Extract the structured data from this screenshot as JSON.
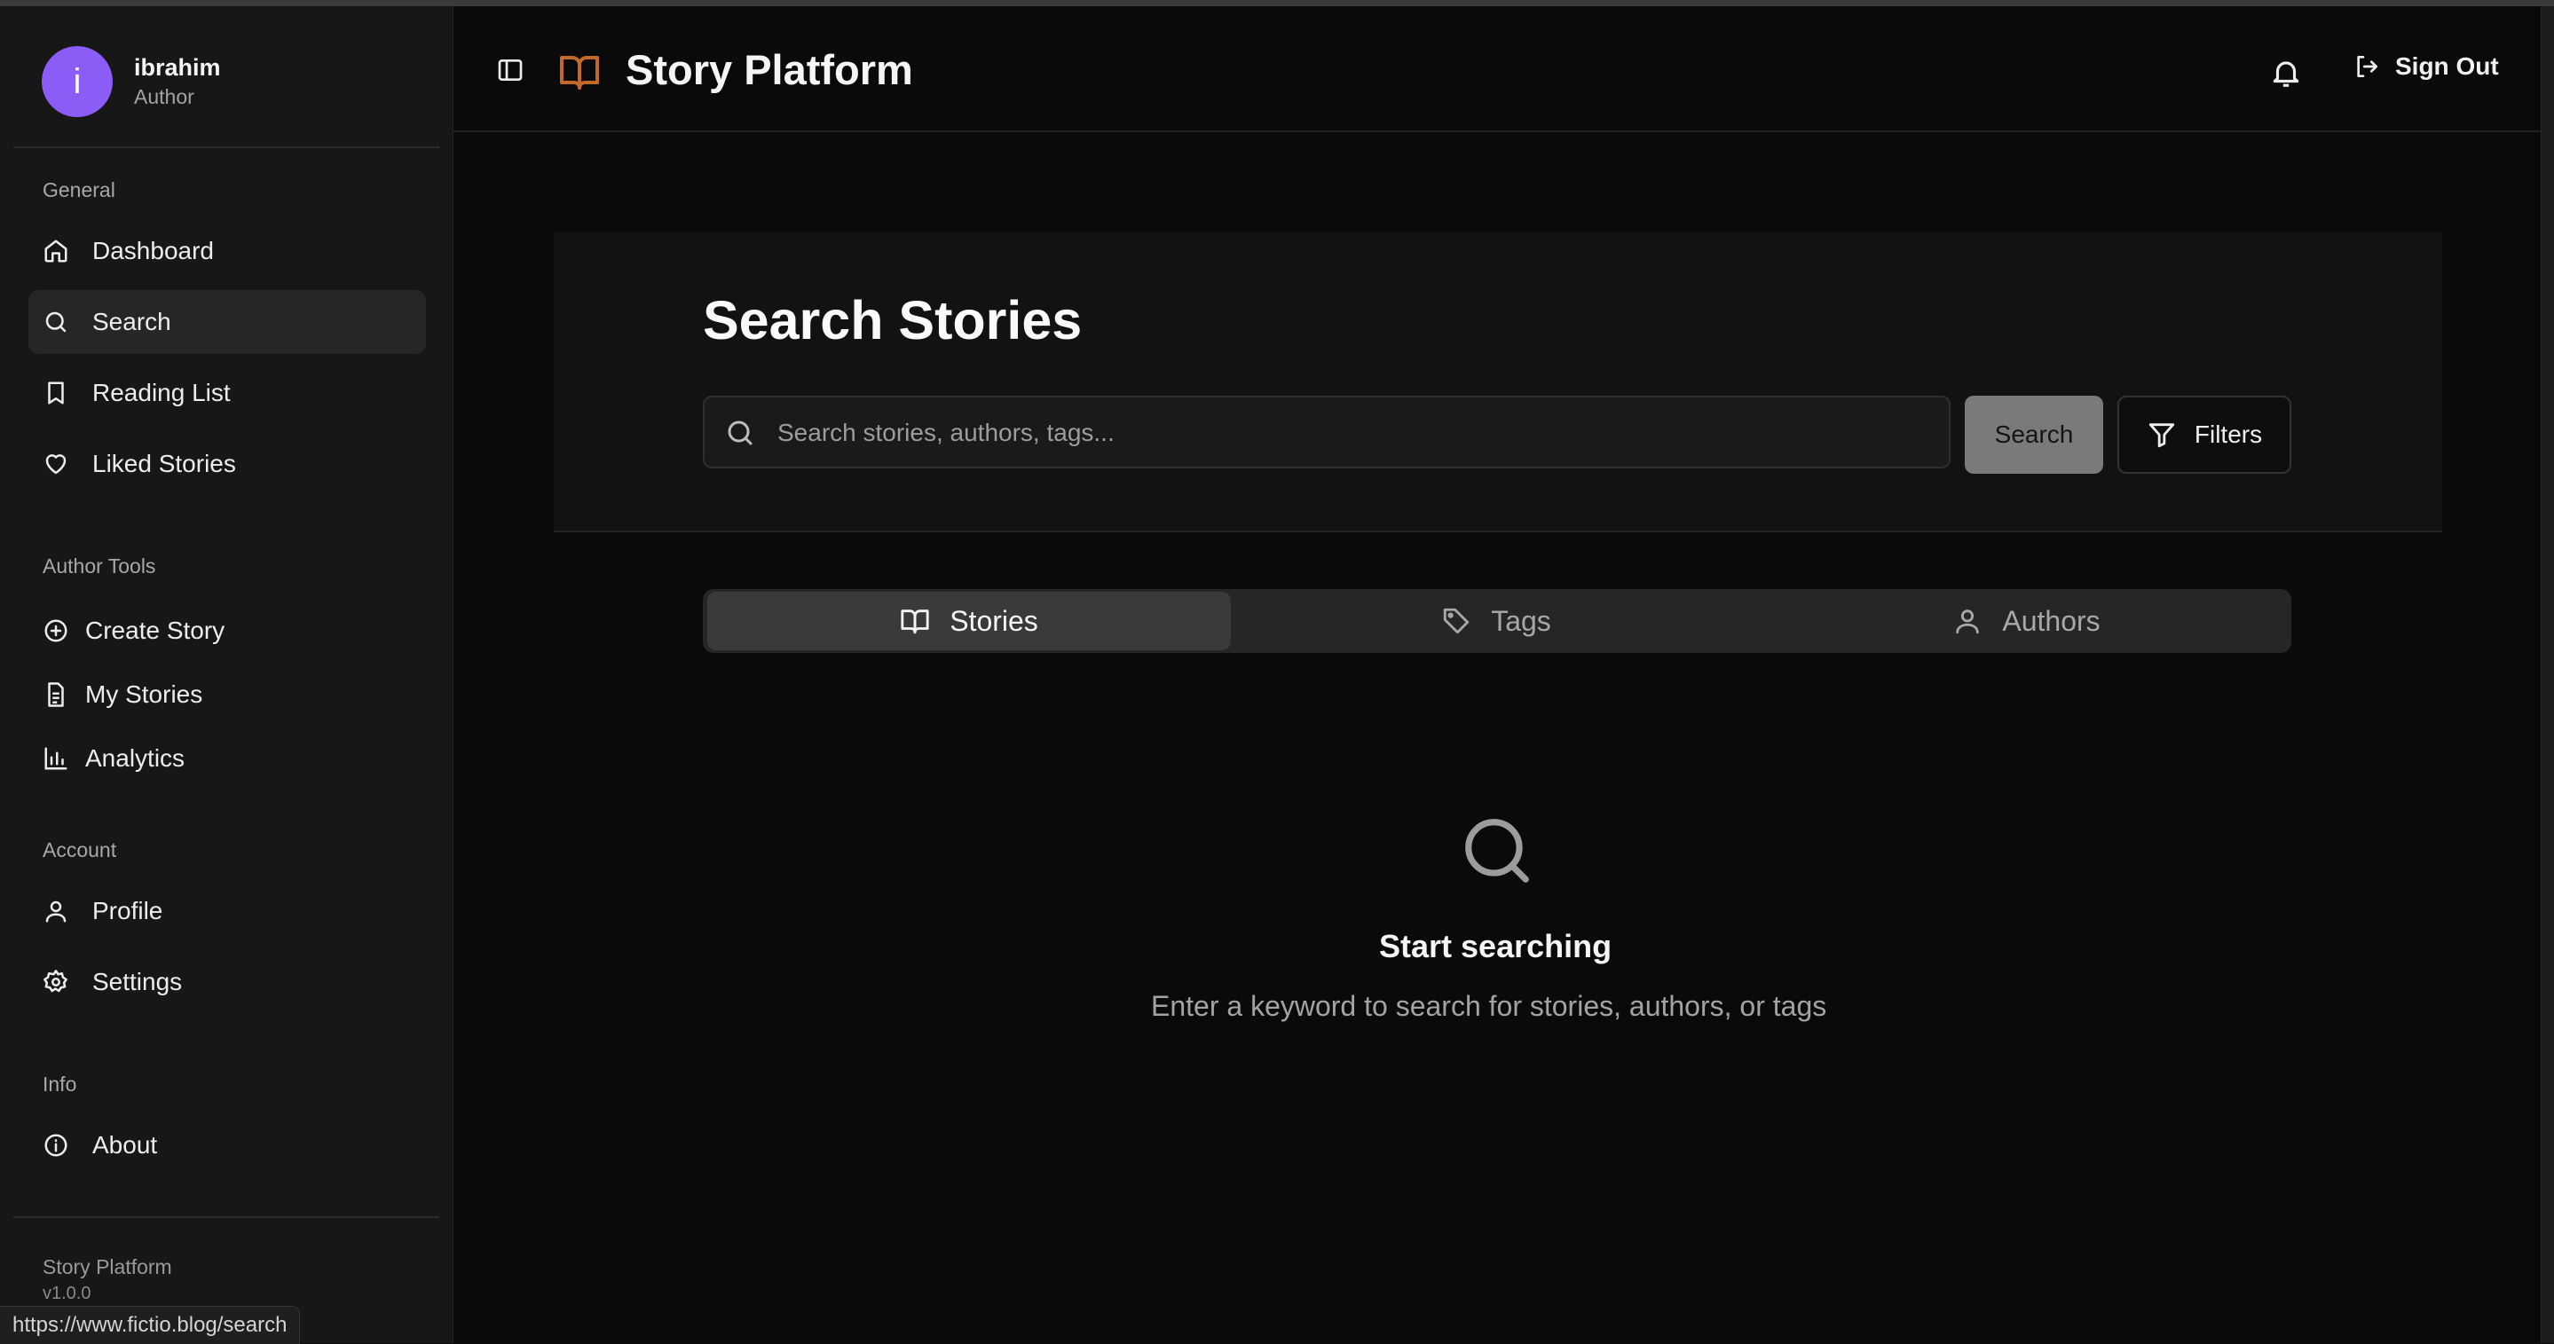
{
  "user": {
    "initial": "i",
    "name": "ibrahim",
    "role": "Author"
  },
  "sidebar": {
    "sections": [
      {
        "label": "General"
      },
      {
        "label": "Author Tools"
      },
      {
        "label": "Account"
      },
      {
        "label": "Info"
      }
    ],
    "general": [
      "Dashboard",
      "Search",
      "Reading List",
      "Liked Stories"
    ],
    "author_tools": [
      "Create Story",
      "My Stories",
      "Analytics"
    ],
    "account": [
      "Profile",
      "Settings"
    ],
    "info": [
      "About"
    ],
    "footer_name": "Story Platform",
    "footer_version": "v1.0.0"
  },
  "status_url": "https://www.fictio.blog/search",
  "header": {
    "title": "Story Platform",
    "sign_out": "Sign Out"
  },
  "search": {
    "title": "Search Stories",
    "placeholder": "Search stories, authors, tags...",
    "button": "Search",
    "filters": "Filters"
  },
  "tabs": [
    "Stories",
    "Tags",
    "Authors"
  ],
  "empty": {
    "title": "Start searching",
    "subtitle": "Enter a keyword to search for stories, authors, or tags"
  },
  "colors": {
    "accent": "#c2692a",
    "avatar": "#8b5cf6",
    "background": "#0a0a0a"
  }
}
